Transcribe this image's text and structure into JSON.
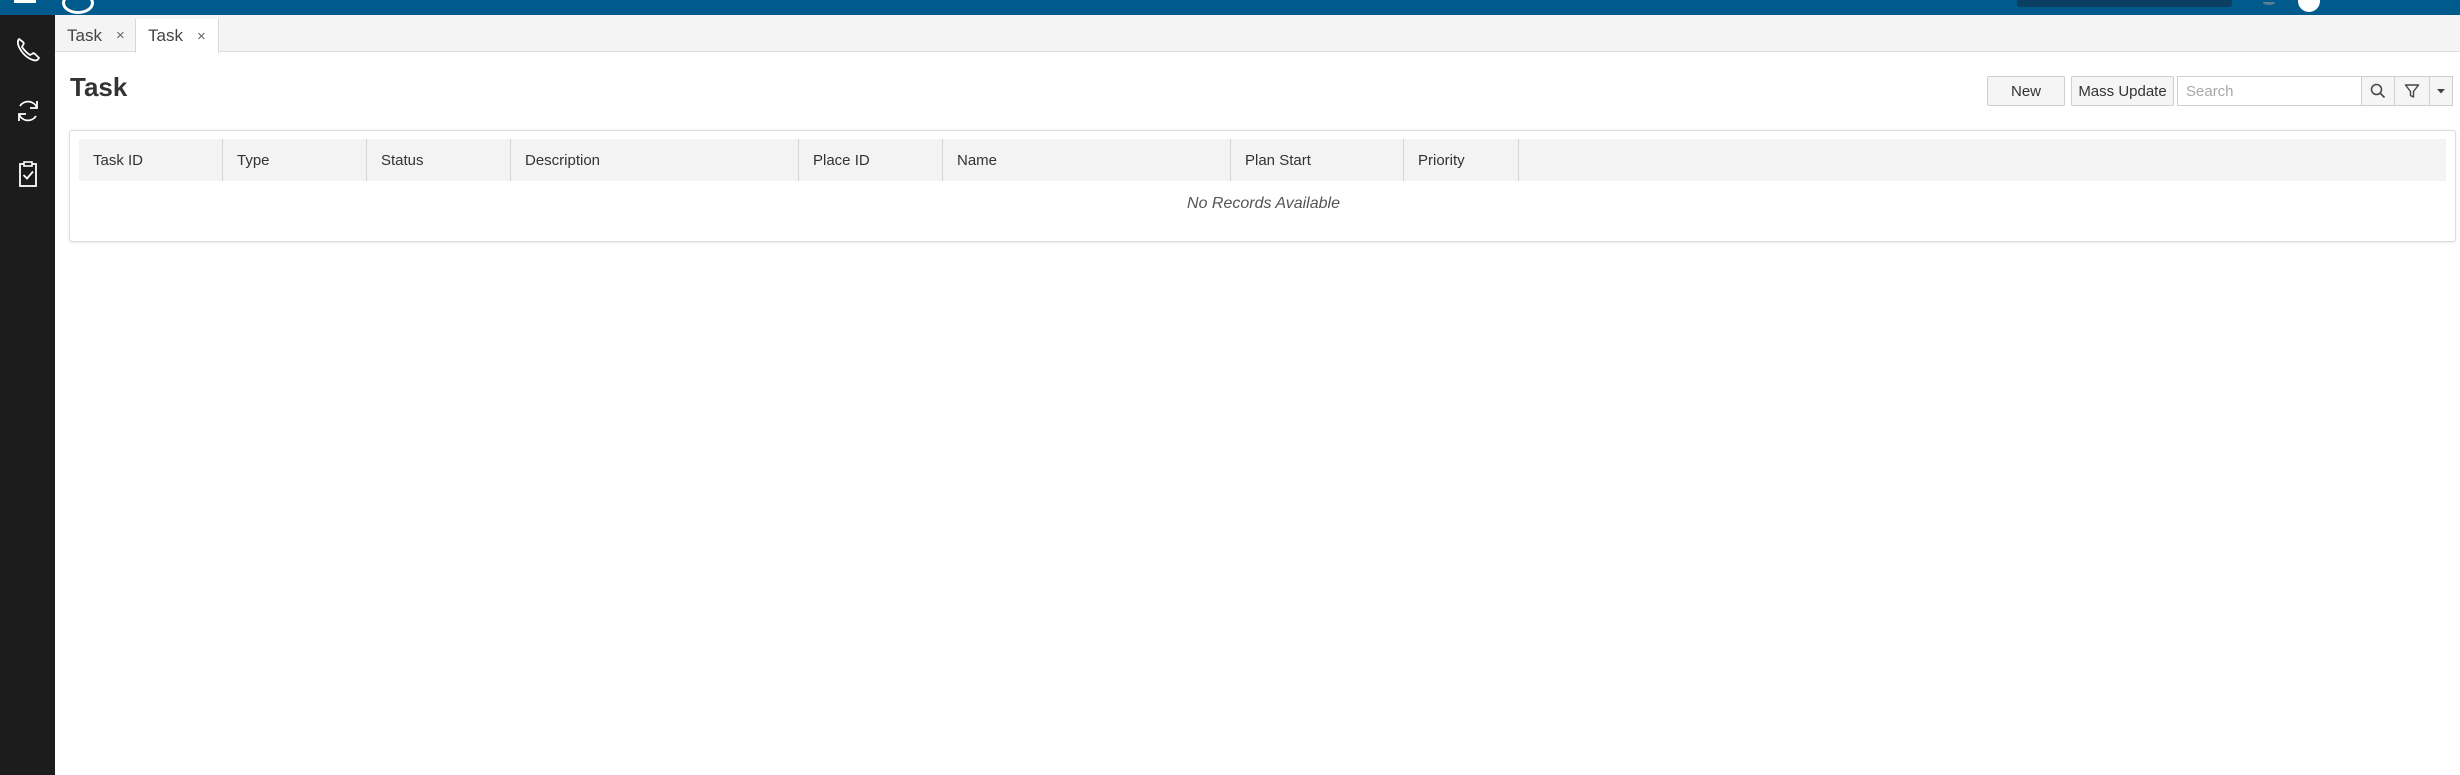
{
  "tabs": [
    {
      "label": "Task",
      "close": "×"
    },
    {
      "label": "Task",
      "close": "×"
    }
  ],
  "page": {
    "title": "Task"
  },
  "toolbar": {
    "new_label": "New",
    "mass_update_label": "Mass Update",
    "search_placeholder": "Search"
  },
  "grid": {
    "columns": [
      "Task ID",
      "Type",
      "Status",
      "Description",
      "Place ID",
      "Name",
      "Plan Start",
      "Priority"
    ],
    "empty_message": "No Records Available"
  },
  "colors": {
    "topbar": "#005a8c",
    "sidebar": "#1c1c1c",
    "header_row": "#f3f3f3"
  },
  "icons": {
    "nav": [
      "phone-icon",
      "sync-icon",
      "clipboard-check-icon"
    ],
    "toolbar": [
      "search-icon",
      "filter-icon",
      "caret-down-icon"
    ]
  }
}
